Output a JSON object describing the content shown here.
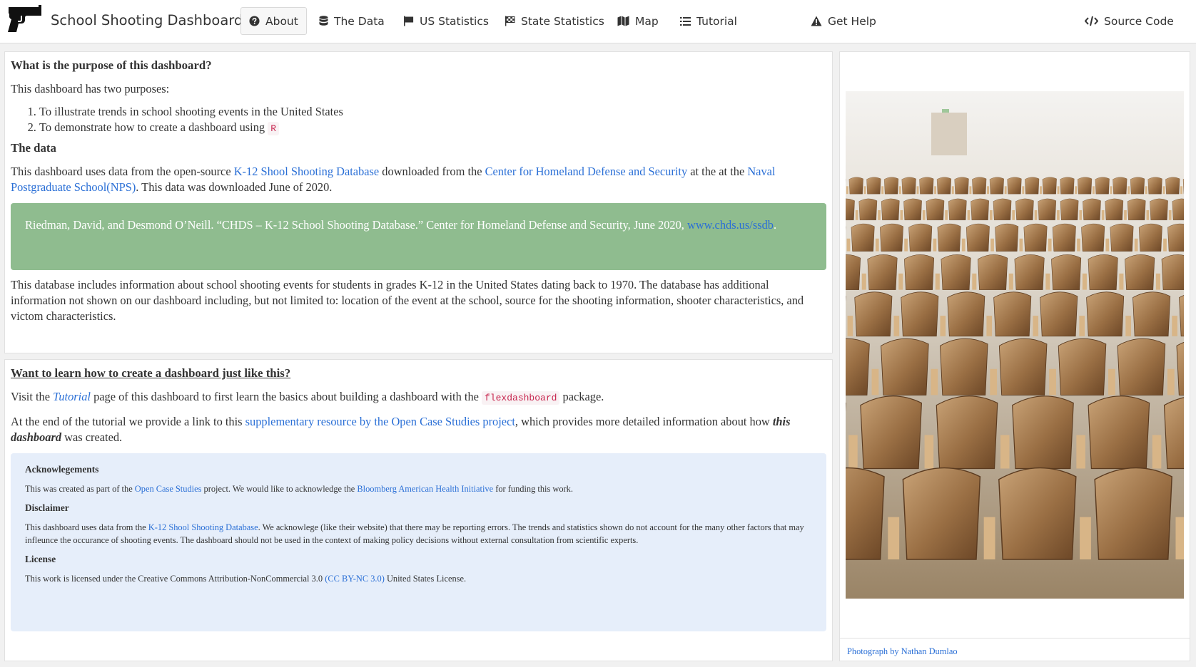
{
  "nav": {
    "title": "School Shooting Dashboard",
    "items": [
      {
        "label": "About",
        "icon": "question-circle-icon",
        "active": true
      },
      {
        "label": "The Data",
        "icon": "database-icon"
      },
      {
        "label": "US Statistics",
        "icon": "flag-icon"
      },
      {
        "label": "State Statistics",
        "icon": "flag-checkered-icon"
      },
      {
        "label": "Map",
        "icon": "map-icon"
      },
      {
        "label": "Tutorial",
        "icon": "list-icon"
      },
      {
        "label": "Get Help",
        "icon": "warning-icon"
      }
    ],
    "source_code": {
      "label": "Source Code",
      "icon": "code-icon"
    }
  },
  "about": {
    "heading": "What is the purpose of this dashboard?",
    "intro": "This dashboard has two purposes:",
    "purpose_1": "To illustrate trends in school shooting events in the United States",
    "purpose_2_text": "To demonstrate how to create a dashboard using ",
    "purpose_2_code": "R",
    "data_heading": "The data",
    "data_p1": "This dashboard uses data from the open-source ",
    "data_link1": "K-12 Shool Shooting Database",
    "data_p2": " downloaded from the ",
    "data_link2": "Center for Homeland Defense and Security",
    "data_p3": " at the at the ",
    "data_link3": "Naval Postgraduate School(NPS)",
    "data_p4": ". This data was downloaded June of 2020.",
    "citation_text": "Riedman, David, and Desmond O’Neill. “CHDS – K-12 School Shooting Database.” Center for Homeland Defense and Security, June 2020, ",
    "citation_link": "www.chds.us/ssdb",
    "citation_end": ".",
    "database_desc": "This database includes information about school shooting events for students in grades K-12 in the United States dating back to 1970. The database has additional information not shown on our dashboard including, but not limited to: location of the event at the school, source for the shooting information, shooter characteristics, and victom characteristics."
  },
  "learn": {
    "heading": "Want to learn how to create a dashboard just like this?",
    "visit_1": "Visit the ",
    "visit_link": "Tutorial",
    "visit_2": " page of this dashboard to first learn the basics about building a dashboard with the ",
    "visit_code": "flexdashboard",
    "visit_3": " package.",
    "end_1": "At the end of the tutorial we provide a link to this ",
    "end_link": "supplementary resource by the Open Case Studies project",
    "end_2": ", which provides more detailed information about how ",
    "end_em": "this dashboard",
    "end_3": " was created.",
    "ack_heading": "Acknowlegements",
    "ack_1": "This was created as part of the ",
    "ack_link1": "Open Case Studies",
    "ack_2": " project. We would like to acknowledge the ",
    "ack_link2": "Bloomberg American Health Initiative",
    "ack_3": " for funding this work.",
    "disclaimer_heading": "Disclaimer",
    "disc_1": "This dashboard uses data from the ",
    "disc_link": "K-12 Shool Shooting Database",
    "disc_2": ". We acknowlege (like their website) that there may be reporting errors. The trends and statistics shown do not account for the many other factors that may infleunce the occurance of shooting events. The dashboard should not be used in the context of making policy decisions without external consultation from scientific experts.",
    "license_heading": "License",
    "lic_1": "This work is licensed under the Creative Commons Attribution-NonCommercial 3.0 ",
    "lic_link": "(CC BY-NC 3.0)",
    "lic_2": " United States License."
  },
  "photo": {
    "credit": "Photograph by Nathan Dumlao",
    "subject": "empty wooden lecture hall chairs"
  }
}
